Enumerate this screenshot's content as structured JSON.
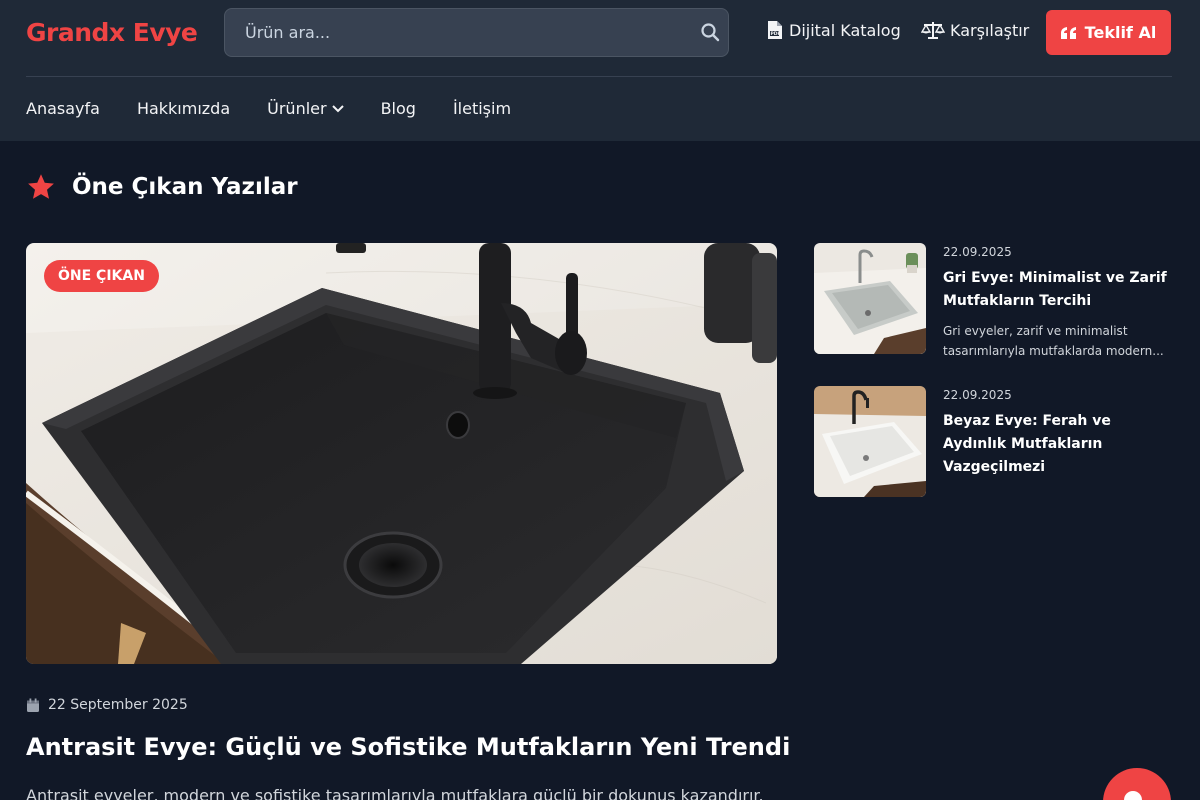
{
  "header": {
    "logo": "Grandx Evye",
    "search_placeholder": "Ürün ara...",
    "catalog_label": "Dijital Katalog",
    "compare_label": "Karşılaştır",
    "quote_label": "Teklif Al"
  },
  "nav": {
    "items": [
      "Anasayfa",
      "Hakkımızda",
      "Ürünler",
      "Blog",
      "İletişim"
    ]
  },
  "featured_section": {
    "title": "Öne Çıkan Yazılar"
  },
  "featured_post": {
    "badge": "ÖNE ÇIKAN",
    "date": "22 September 2025",
    "title": "Antrasit Evye: Güçlü ve Sofistike Mutfakların Yeni Trendi",
    "excerpt": "Antrasit evyeler, modern ve sofistike tasarımlarıyla mutfaklara güçlü bir dokunuş kazandırır."
  },
  "side_posts": [
    {
      "date": "22.09.2025",
      "title": "Gri Evye: Minimalist ve Zarif Mutfakların Tercihi",
      "excerpt_line1": "Gri evyeler, zarif ve minimalist",
      "excerpt_line2": "tasarımlarıyla mutfaklarda modern..."
    },
    {
      "date": "22.09.2025",
      "title": "Beyaz Evye: Ferah ve Aydınlık Mutfakların Vazgeçilmezi"
    }
  ],
  "colors": {
    "accent": "#ef4444",
    "header_bg": "#1f2937",
    "page_bg": "#111827"
  }
}
